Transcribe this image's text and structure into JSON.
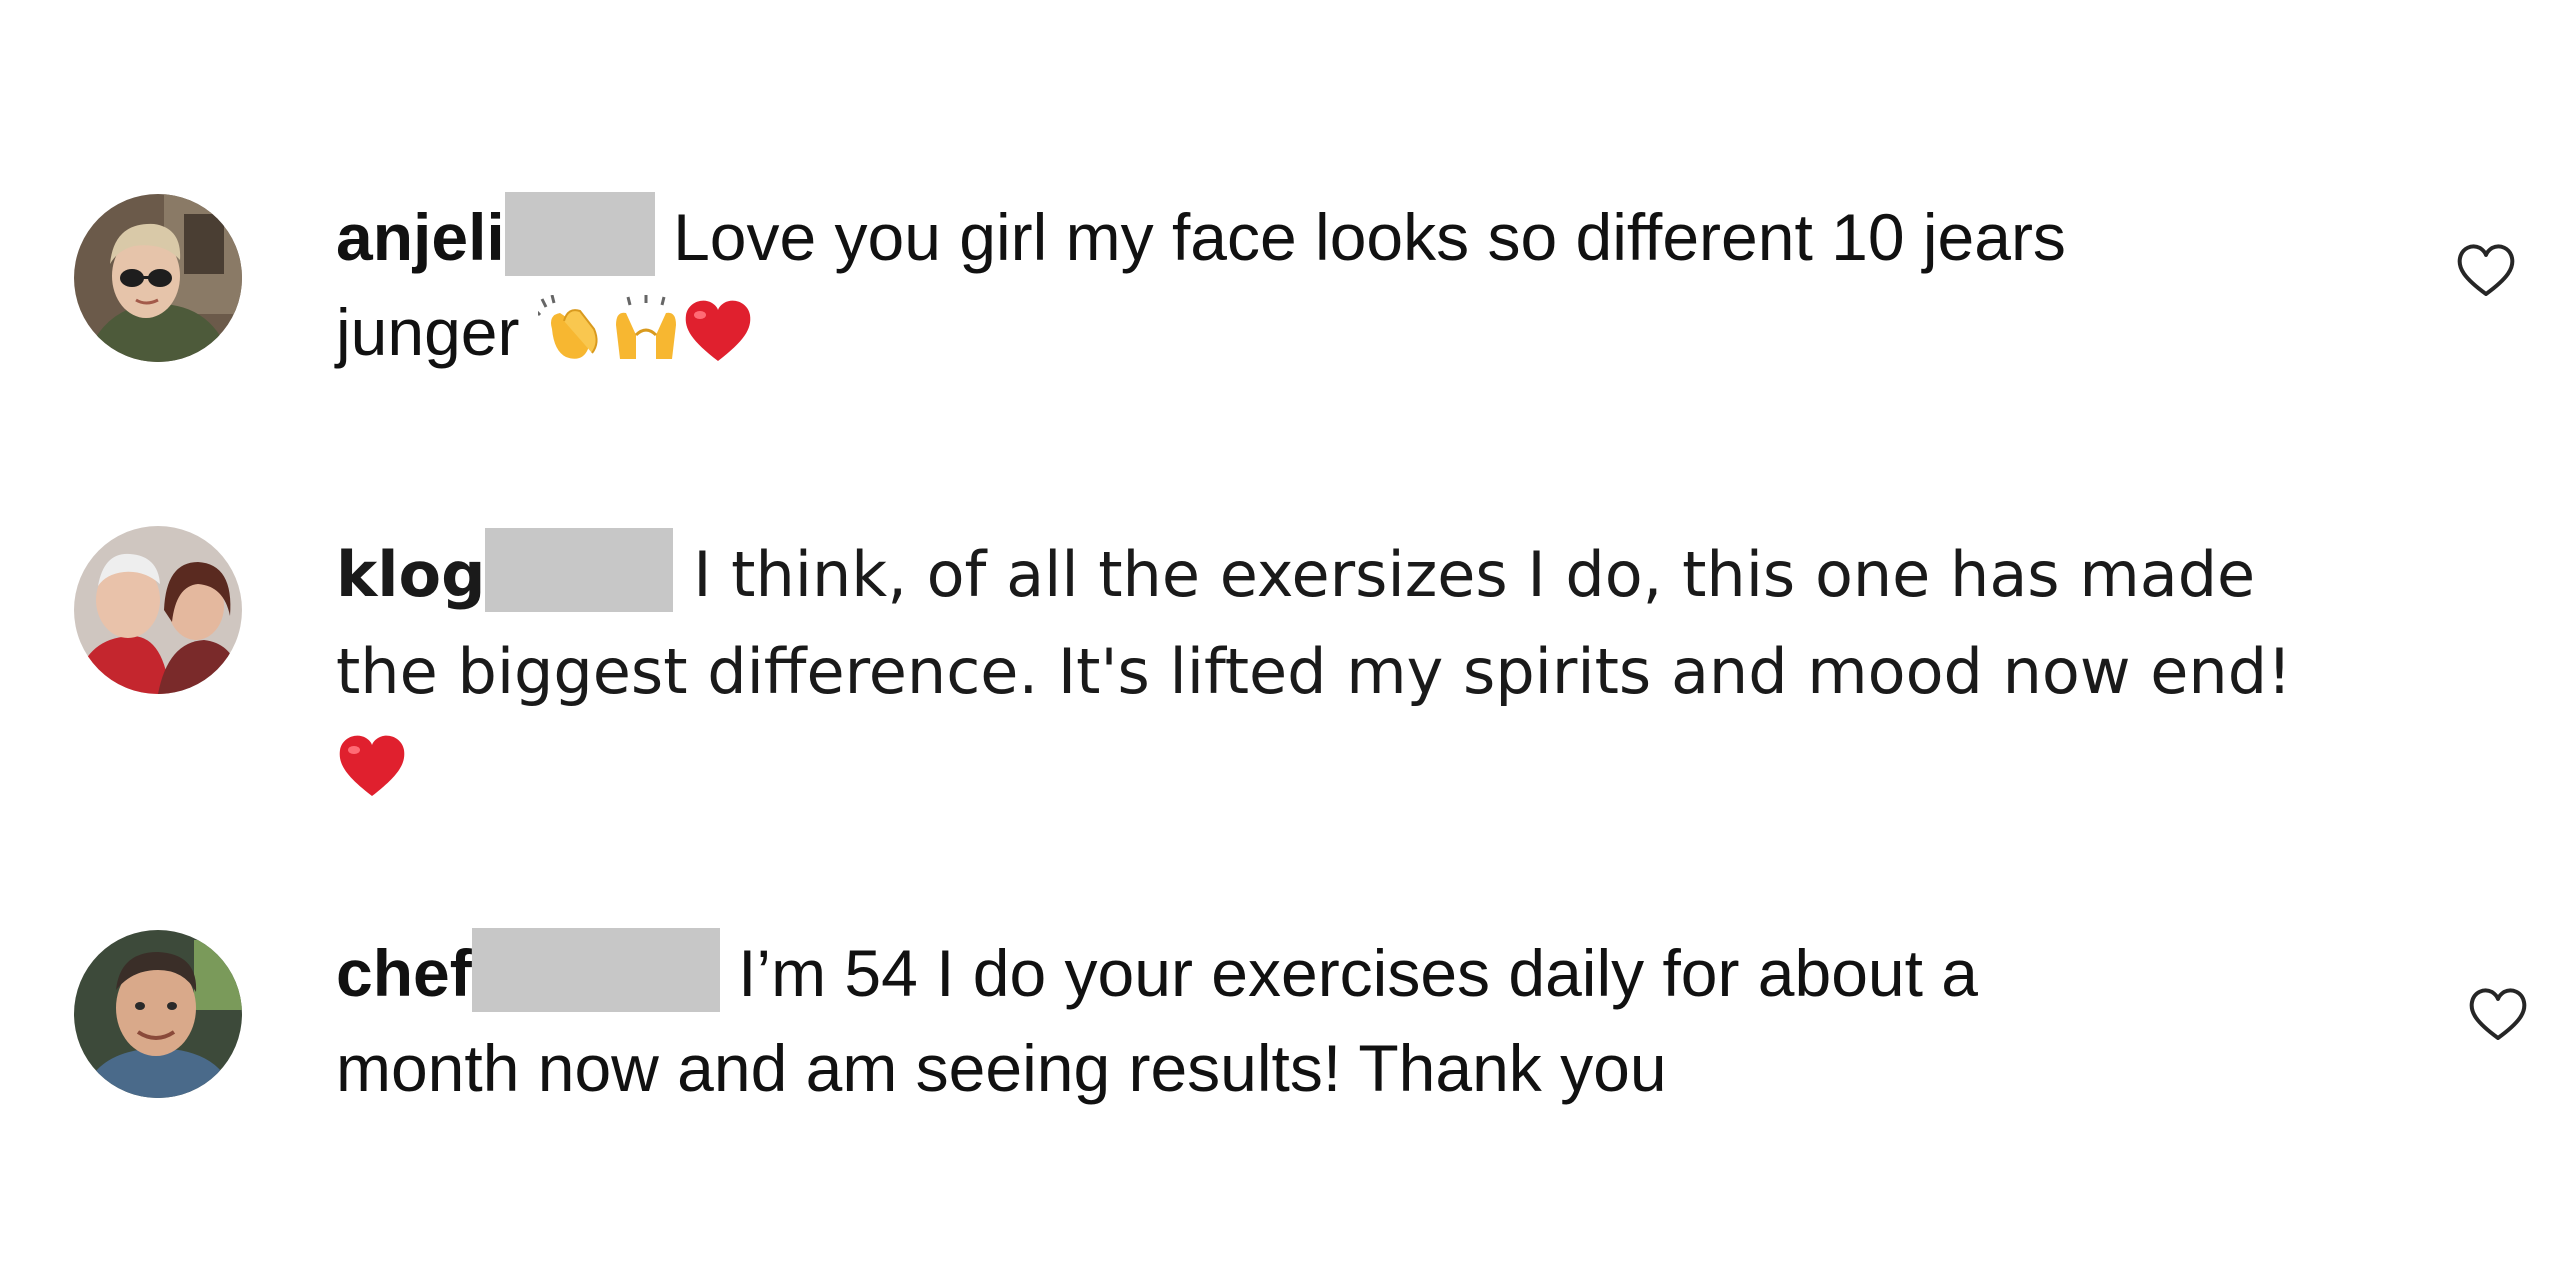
{
  "comments": [
    {
      "username": "anjeli",
      "text_line1": "Love you girl my face looks so different 10 jears",
      "text_line2": "junger",
      "emoji": [
        "clapping-hands",
        "raising-hands",
        "red-heart"
      ],
      "like_icon": "heart-outline-icon"
    },
    {
      "username": "klog",
      "text_line1": "I think, of all the exersizes I do, this one has made",
      "text_line2": "the biggest difference. It's lifted my spirits and mood now end!",
      "emoji": [
        "red-heart"
      ]
    },
    {
      "username": "chef",
      "text_line1": "I’m 54 I do your exercises daily for about a",
      "text_line2": "month now and am seeing results! Thank you",
      "like_icon": "heart-outline-icon"
    }
  ],
  "colors": {
    "text": "#111111",
    "redaction": "#c7c7c7",
    "heart_red": "#e0202e",
    "emoji_yellow": "#f7b731"
  }
}
